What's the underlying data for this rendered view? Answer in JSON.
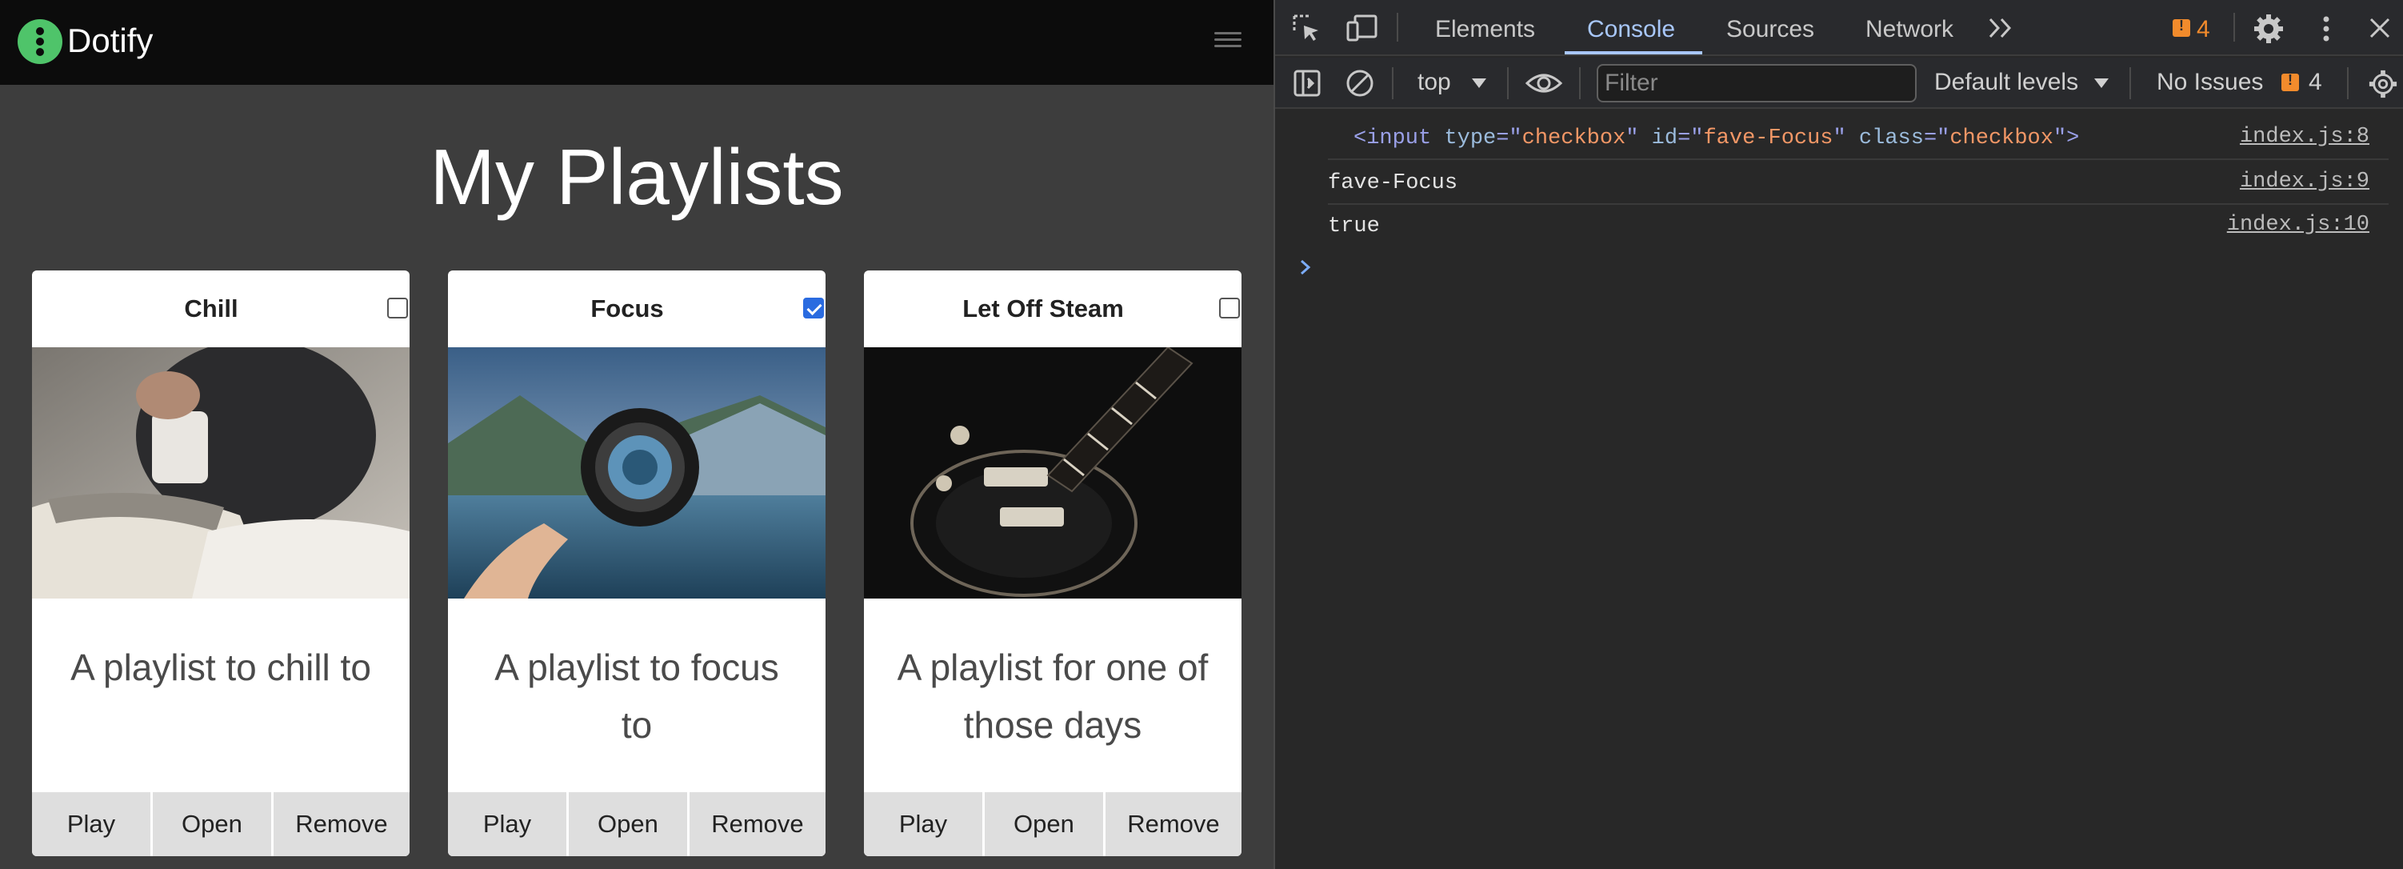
{
  "app": {
    "brand": "Dotify",
    "page_title": "My Playlists",
    "playlists": [
      {
        "name": "Chill",
        "favorite": false,
        "description": "A playlist to chill to",
        "image": "person-reading-with-mug-image"
      },
      {
        "name": "Focus",
        "favorite": true,
        "description": "A playlist to focus to",
        "image": "lens-over-lake-image"
      },
      {
        "name": "Let Off Steam",
        "favorite": false,
        "description": "A playlist for one of those days",
        "image": "electric-guitar-image"
      }
    ],
    "actions": {
      "play": "Play",
      "open": "Open",
      "remove": "Remove"
    }
  },
  "devtools": {
    "tabs": [
      "Elements",
      "Console",
      "Sources",
      "Network"
    ],
    "active_tab": "Console",
    "issues_count": "4",
    "toolbar": {
      "context": "top",
      "filter_placeholder": "Filter",
      "levels": "Default levels",
      "no_issues": "No Issues",
      "issues_count": "4"
    },
    "console": [
      {
        "type": "element",
        "tag": "input",
        "attrs": [
          {
            "name": "type",
            "value": "checkbox"
          },
          {
            "name": "id",
            "value": "fave-Focus"
          },
          {
            "name": "class",
            "value": "checkbox"
          }
        ],
        "source": "index.js:8"
      },
      {
        "type": "string",
        "text": "fave-Focus",
        "source": "index.js:9"
      },
      {
        "type": "boolean",
        "text": "true",
        "source": "index.js:10"
      }
    ],
    "colors": {
      "accent": "#a8c7fa",
      "issue": "#f28b2c",
      "checkbox_checked": "#2a6be0",
      "logo": "#4fc46a"
    }
  }
}
